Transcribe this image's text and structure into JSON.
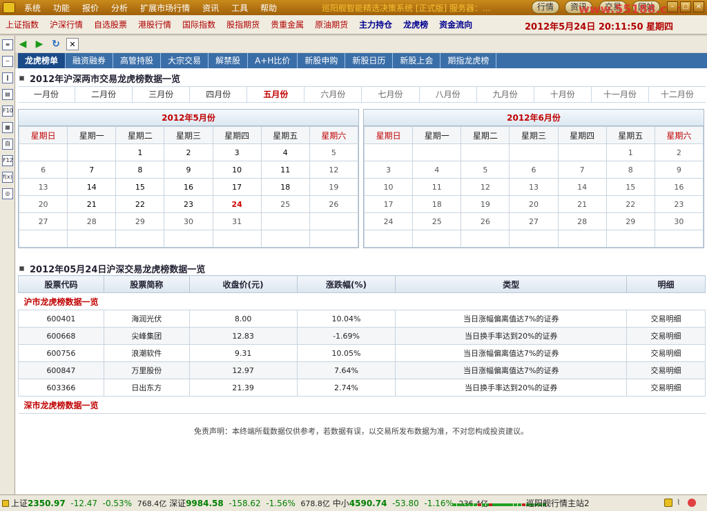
{
  "app": {
    "title": "巡阳舰智能精选决策系统 [正式版] 服务器：...",
    "menu": [
      "系统",
      "功能",
      "报价",
      "分析",
      "扩展市场行情",
      "资讯",
      "工具",
      "帮助"
    ],
    "top_buttons": [
      "行情",
      "资讯",
      "交易",
      "网站"
    ],
    "watermark": "www.55188.com"
  },
  "quote_bar": {
    "items": [
      "上证指数",
      "沪深行情",
      "自选股票",
      "港股行情",
      "国际指数",
      "股指期货",
      "贵重金属",
      "原油期货"
    ],
    "bold_items": [
      "主力持仓",
      "龙虎榜",
      "资金流向"
    ],
    "datetime": "2012年5月24日  20:11:50  星期四"
  },
  "toolbar": {
    "close": "✕"
  },
  "left_icons": [
    "list-icon",
    "line-chart-icon",
    "candle-icon",
    "table-icon",
    "f10-icon",
    "grid-icon",
    "book-icon",
    "f12-icon",
    "fx-icon",
    "search-icon"
  ],
  "left_labels": [
    "≡",
    "~",
    "‖",
    "▤",
    "F10",
    "▦",
    "自",
    "F12",
    "f(x)",
    "◎"
  ],
  "tabs": [
    "龙虎榜单",
    "融资融券",
    "高管持股",
    "大宗交易",
    "解禁股",
    "A+H比价",
    "新股申购",
    "新股日历",
    "新股上会",
    "期指龙虎榜"
  ],
  "section1": {
    "title": "2012年沪深两市交易龙虎榜数据一览"
  },
  "months": [
    "一月份",
    "二月份",
    "三月份",
    "四月份",
    "五月份",
    "六月份",
    "七月份",
    "八月份",
    "九月份",
    "十月份",
    "十一月份",
    "十二月份"
  ],
  "weekdays": [
    "星期日",
    "星期一",
    "星期二",
    "星期三",
    "星期四",
    "星期五",
    "星期六"
  ],
  "cal_may": {
    "title": "2012年5月份",
    "rows": [
      [
        "",
        "",
        "1",
        "2",
        "3",
        "4",
        "5"
      ],
      [
        "6",
        "7",
        "8",
        "9",
        "10",
        "11",
        "12"
      ],
      [
        "13",
        "14",
        "15",
        "16",
        "17",
        "18",
        "19"
      ],
      [
        "20",
        "21",
        "22",
        "23",
        "24",
        "25",
        "26"
      ],
      [
        "27",
        "28",
        "29",
        "30",
        "31",
        "",
        ""
      ],
      [
        "",
        "",
        "",
        "",
        "",
        "",
        ""
      ]
    ]
  },
  "cal_june": {
    "title": "2012年6月份",
    "rows": [
      [
        "",
        "",
        "",
        "",
        "",
        "1",
        "2"
      ],
      [
        "3",
        "4",
        "5",
        "6",
        "7",
        "8",
        "9"
      ],
      [
        "10",
        "11",
        "12",
        "13",
        "14",
        "15",
        "16"
      ],
      [
        "17",
        "18",
        "19",
        "20",
        "21",
        "22",
        "23"
      ],
      [
        "24",
        "25",
        "26",
        "27",
        "28",
        "29",
        "30"
      ],
      [
        "",
        "",
        "",
        "",
        "",
        "",
        ""
      ]
    ]
  },
  "section2": {
    "title": "2012年05月24日沪深交易龙虎榜数据一览"
  },
  "table": {
    "headers": [
      "股票代码",
      "股票简称",
      "收盘价(元)",
      "涨跌幅(%)",
      "类型",
      "明细"
    ],
    "sh_group": "沪市龙虎榜数据一览",
    "sz_group": "深市龙虎榜数据一览",
    "rows": [
      {
        "code": "600401",
        "name": "海润光伏",
        "close": "8.00",
        "chg": "10.04%",
        "type": "当日涨幅偏离值达7%的证券",
        "detail": "交易明细"
      },
      {
        "code": "600668",
        "name": "尖峰集团",
        "close": "12.83",
        "chg": "-1.69%",
        "type": "当日换手率达到20%的证券",
        "detail": "交易明细"
      },
      {
        "code": "600756",
        "name": "浪潮软件",
        "close": "9.31",
        "chg": "10.05%",
        "type": "当日涨幅偏离值达7%的证券",
        "detail": "交易明细"
      },
      {
        "code": "600847",
        "name": "万里股份",
        "close": "12.97",
        "chg": "7.64%",
        "type": "当日涨幅偏离值达7%的证券",
        "detail": "交易明细"
      },
      {
        "code": "603366",
        "name": "日出东方",
        "close": "21.39",
        "chg": "2.74%",
        "type": "当日换手率达到20%的证券",
        "detail": "交易明细"
      }
    ]
  },
  "disclaimer": "免责声明：本终端所载数据仅供参考，若数据有误，以交易所发布数据为准，不对您构成投资建议。",
  "status": {
    "sh_label": "上证",
    "sh_val": "2350.97",
    "sh_chg": "-12.47",
    "sh_pct": "-0.53%",
    "sh_amt": "768.4亿",
    "sz_label": "深证",
    "sz_val": "9984.58",
    "sz_chg": "-158.62",
    "sz_pct": "-1.56%",
    "sz_amt": "678.8亿",
    "zx_label": "中小",
    "zx_val": "4590.74",
    "zx_chg": "-53.80",
    "zx_pct": "-1.16%",
    "zx_amt": "236.4亿",
    "server": "巡阳舰行情主站2"
  }
}
